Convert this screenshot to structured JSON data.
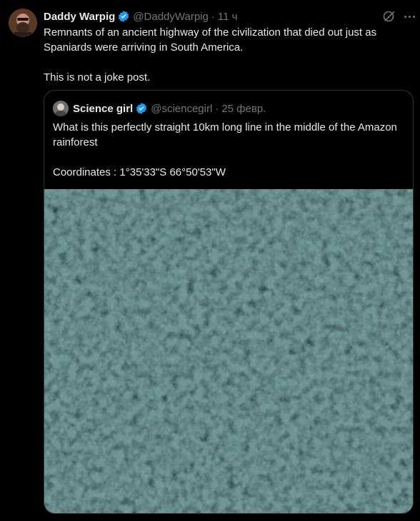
{
  "tweet": {
    "author_name": "Daddy Warpig",
    "handle": "@DaddyWarpig",
    "separator": "·",
    "time": "11 ч",
    "paragraphs": [
      "Remnants of an ancient highway of the civilization that died out just as Spaniards were arriving in South America.",
      "This is not a joke post."
    ],
    "icons": {
      "verified": "verified-badge-icon",
      "grok": "grok-icon",
      "more": "more-options-icon"
    }
  },
  "quoted": {
    "author_name": "Science girl",
    "handle": "@sciencegirl",
    "separator": "·",
    "time": "25 февр.",
    "paragraphs": [
      "What is this perfectly straight 10km long line in the middle of the Amazon rainforest",
      "Coordinates : 1°35'33\"S 66°50'53\"W"
    ],
    "media": "satellite image of dense rainforest canopy"
  },
  "colors": {
    "background": "#000000",
    "text": "#e7e9ea",
    "muted": "#71767b",
    "verified": "#1d9bf0",
    "border": "#2f3336"
  }
}
